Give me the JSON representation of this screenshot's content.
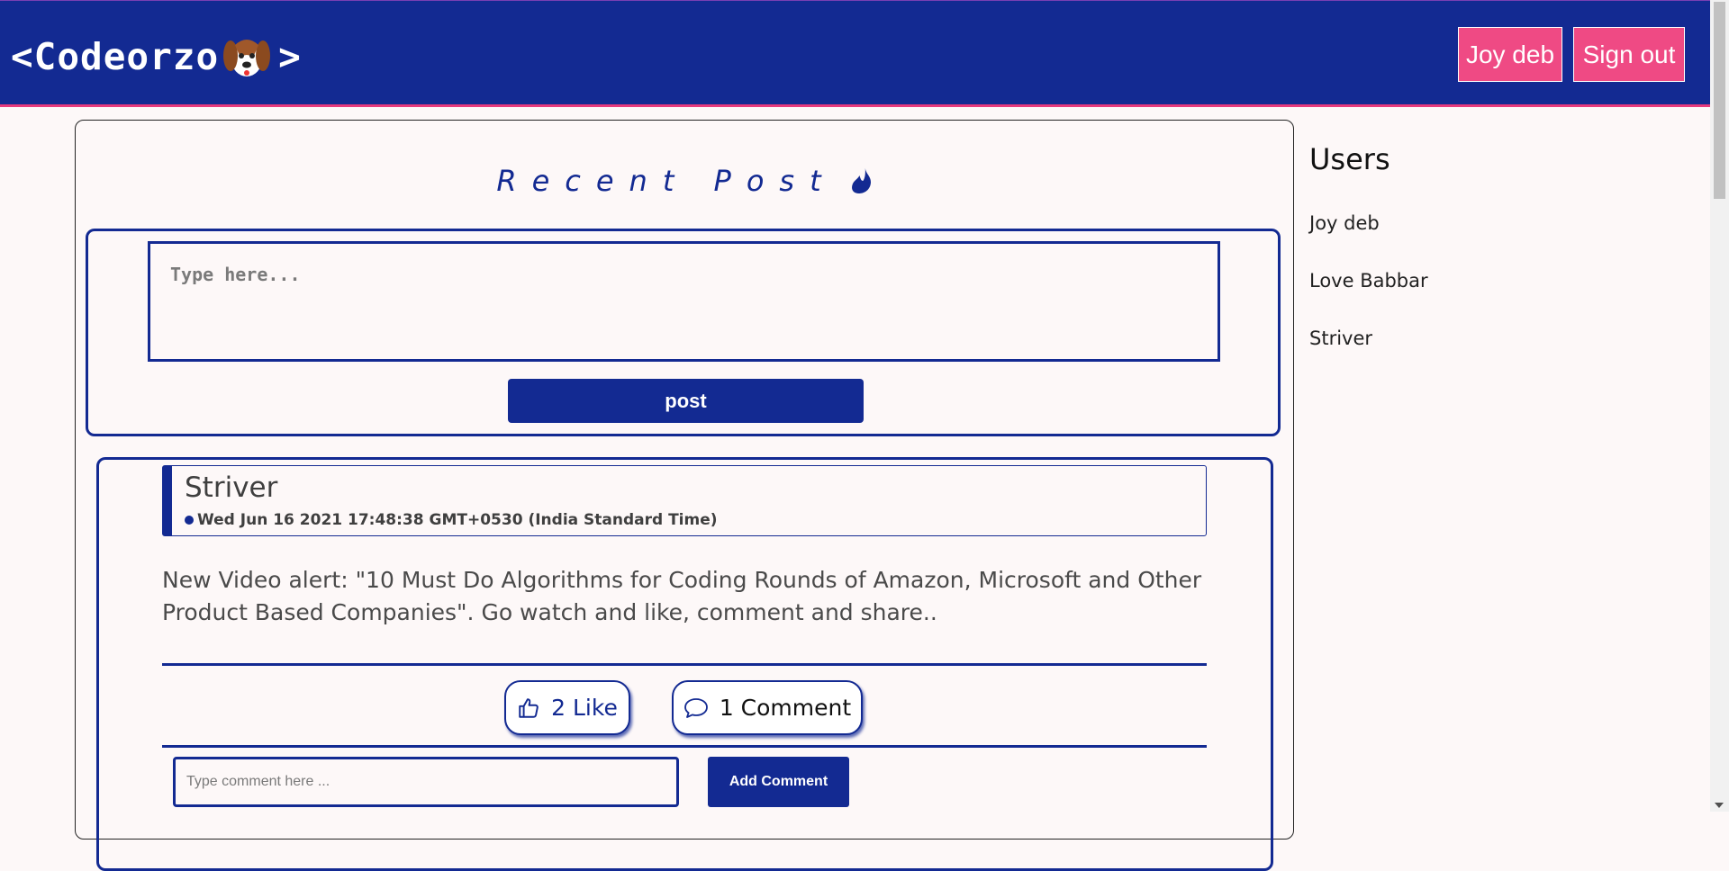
{
  "header": {
    "logo_left": "<Codeorzo",
    "logo_right": ">",
    "logo_icon": "dog-face-icon",
    "user_button": "Joy deb",
    "signout_button": "Sign out"
  },
  "main": {
    "title": "Recent Post",
    "title_icon": "flame-icon",
    "composer": {
      "placeholder": "Type here...",
      "post_label": "post"
    }
  },
  "post": {
    "author": "Striver",
    "date": "Wed Jun 16 2021 17:48:38 GMT+0530 (India Standard Time)",
    "text": "New Video alert: \"10 Must Do Algorithms for Coding Rounds of Amazon, Microsoft and Other Product Based Companies\". Go watch and like, comment and share..",
    "like_label": "2 Like",
    "comment_label": "1 Comment",
    "comment_placeholder": "Type comment here ...",
    "add_comment_label": "Add Comment"
  },
  "sidebar": {
    "title": "Users",
    "users": [
      "Joy deb",
      "Love Babbar",
      "Striver"
    ]
  },
  "colors": {
    "primary": "#132a92",
    "accent": "#ef4a84",
    "background": "#fdf8f8"
  }
}
